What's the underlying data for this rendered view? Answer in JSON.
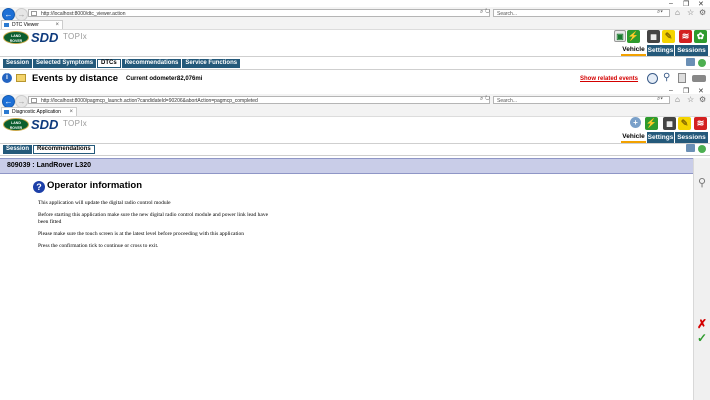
{
  "browser1": {
    "url": "http://localhost:8000/dtc_viewer.action",
    "search_placeholder": "Search...",
    "tab_title": "DTC Viewer",
    "win_min": "–",
    "win_max": "❐",
    "win_close": "✕",
    "tab_close": "×"
  },
  "browser2": {
    "url": "http://localhost:8000/pagmcp_launch.action?candidateId=90206&abortAction=pagmcp_completed",
    "search_placeholder": "Search...",
    "tab_title": "Diagnostic Application",
    "win_min": "–",
    "win_max": "❐",
    "win_close": "✕",
    "tab_close": "×"
  },
  "branding": {
    "logo_line1": "LAND",
    "logo_line2": "ROVER",
    "sdd": "SDD",
    "topix": "TOPIx"
  },
  "main_tabs": [
    "Vehicle",
    "Settings",
    "Sessions"
  ],
  "top_nav": [
    "Session",
    "Selected Symptoms",
    "DTCs",
    "Recommendations",
    "Service Functions"
  ],
  "top_nav_active": "DTCs",
  "dtc": {
    "title": "Events by distance",
    "odometer_label": "Current odometer:",
    "odometer_value": "82,076mi",
    "show_related": "Show related events"
  },
  "lower_nav": [
    "Session",
    "Recommendations"
  ],
  "lower_nav_active": "Recommendations",
  "vehicle_header": "809039 : LandRover L320",
  "operator": {
    "title": "Operator information",
    "paragraphs": [
      "This application will update the digital radio control module",
      "Before starting this application make sure the new digital radio control module and power link lead have been fitted",
      "Please make sure the touch screen is at the latest level before proceeding with this application",
      "Press the confirmation tick to continue or cross to exit."
    ]
  },
  "icons": {
    "info": "info-icon",
    "question": "question-icon",
    "cross": "cross-icon",
    "tick": "tick-icon"
  },
  "colors": {
    "nav_tab": "#24597a",
    "header_band": "#c9cde8",
    "link_red": "#d40000",
    "accent_orange": "#f2a100"
  }
}
